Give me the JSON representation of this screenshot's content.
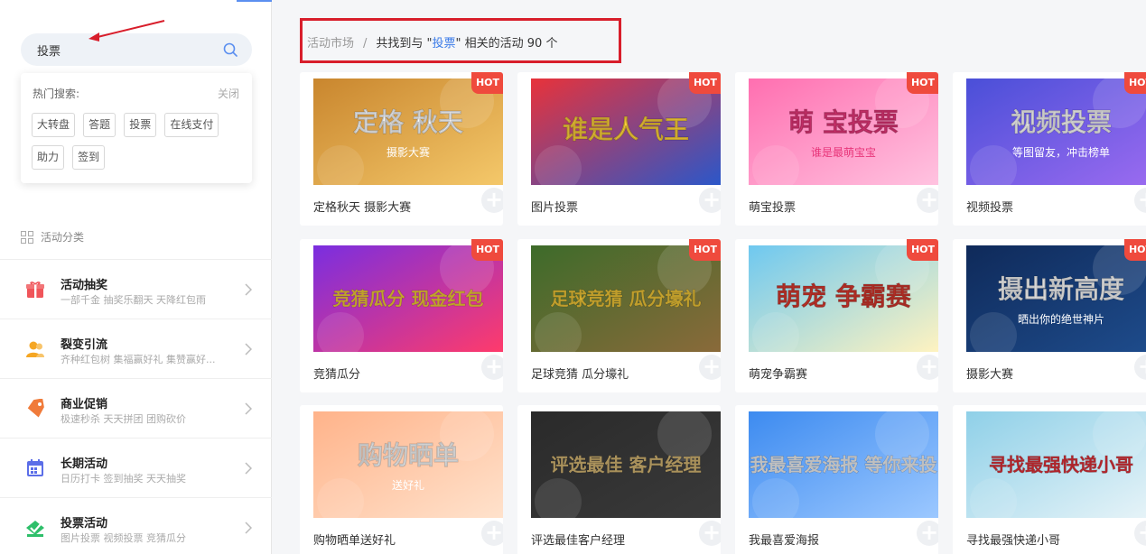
{
  "search": {
    "value": "投票"
  },
  "hot_search": {
    "title": "热门搜索:",
    "close_label": "关闭",
    "tags": [
      "大转盘",
      "答题",
      "投票",
      "在线支付",
      "助力",
      "签到"
    ]
  },
  "categories": {
    "title": "活动分类",
    "items": [
      {
        "name": "活动抽奖",
        "sub": "一部千金   抽奖乐翻天   天降红包雨",
        "color": "#f0555a",
        "icon": "gift-icon"
      },
      {
        "name": "裂变引流",
        "sub": "齐种红包树   集福赢好礼   集赞赢好...",
        "color": "#f5a623",
        "icon": "people-icon"
      },
      {
        "name": "商业促销",
        "sub": "极速秒杀   天天拼团   团购砍价",
        "color": "#f07b3a",
        "icon": "tag-icon"
      },
      {
        "name": "长期活动",
        "sub": "日历打卡   签到抽奖   天天抽奖",
        "color": "#5b6ee8",
        "icon": "calendar-icon"
      },
      {
        "name": "投票活动",
        "sub": "图片投票   视频投票   竞猜瓜分",
        "color": "#2ebf6a",
        "icon": "vote-icon"
      }
    ]
  },
  "breadcrumb": {
    "root": "活动市场",
    "separator": "/",
    "prefix": "共找到与 \"",
    "keyword": "投票",
    "suffix": "\" 相关的活动 90 个"
  },
  "hot_label": "HOT",
  "cards": [
    {
      "title": "定格秋天 摄影大赛",
      "hot": true,
      "thumb_text": "定格 秋天",
      "thumb_sub": "摄影大赛",
      "bg": "#c9862e",
      "bg2": "#f4c86a",
      "fg": "#ffffff"
    },
    {
      "title": "图片投票",
      "hot": true,
      "thumb_text": "谁是人气王",
      "thumb_sub": "",
      "bg": "#e8323a",
      "bg2": "#2b57c9",
      "fg": "#ffd23a"
    },
    {
      "title": "萌宝投票",
      "hot": true,
      "thumb_text": "萌 宝投票",
      "thumb_sub": "谁是最萌宝宝",
      "bg": "#ff6fb0",
      "bg2": "#ffc3e0",
      "fg": "#e8367a"
    },
    {
      "title": "视频投票",
      "hot": true,
      "thumb_text": "视频投票",
      "thumb_sub": "等图留友，冲击榜单",
      "bg": "#4a4fd8",
      "bg2": "#9b6bf0",
      "fg": "#ffffff"
    },
    {
      "title": "竞猜瓜分",
      "hot": true,
      "thumb_text": "竞猜瓜分 现金红包",
      "thumb_sub": "",
      "bg": "#7a2ee0",
      "bg2": "#ff3b6b",
      "fg": "#ffd63a"
    },
    {
      "title": "足球竞猜 瓜分壕礼",
      "hot": true,
      "thumb_text": "足球竞猜 瓜分壕礼",
      "thumb_sub": "",
      "bg": "#3d6b2a",
      "bg2": "#8a6a3a",
      "fg": "#ffd23a"
    },
    {
      "title": "萌宠争霸赛",
      "hot": true,
      "thumb_text": "萌宠 争霸赛",
      "thumb_sub": "",
      "bg": "#6ec8f0",
      "bg2": "#fff3c0",
      "fg": "#d8382e"
    },
    {
      "title": "摄影大赛",
      "hot": true,
      "thumb_text": "摄出新高度",
      "thumb_sub": "晒出你的绝世神片",
      "bg": "#0f2a5a",
      "bg2": "#1e4c8c",
      "fg": "#ffffff"
    },
    {
      "title": "购物晒单送好礼",
      "hot": false,
      "thumb_text": "购物晒单",
      "thumb_sub": "送好礼",
      "bg": "#ffb38a",
      "bg2": "#ffe2cc",
      "fg": "#ffffff"
    },
    {
      "title": "评选最佳客户经理",
      "hot": false,
      "thumb_text": "评选最佳 客户经理",
      "thumb_sub": "",
      "bg": "#2a2a2a",
      "bg2": "#3a3a3a",
      "fg": "#e2c27a"
    },
    {
      "title": "我最喜爱海报",
      "hot": false,
      "thumb_text": "我最喜爱海报 等你来投",
      "thumb_sub": "",
      "bg": "#3d8bf0",
      "bg2": "#9cc8ff",
      "fg": "#ffffff"
    },
    {
      "title": "寻找最强快递小哥",
      "hot": false,
      "thumb_text": "寻找最强快递小哥",
      "thumb_sub": "",
      "bg": "#8fd0e8",
      "bg2": "#e8f4f8",
      "fg": "#e8323a"
    }
  ]
}
